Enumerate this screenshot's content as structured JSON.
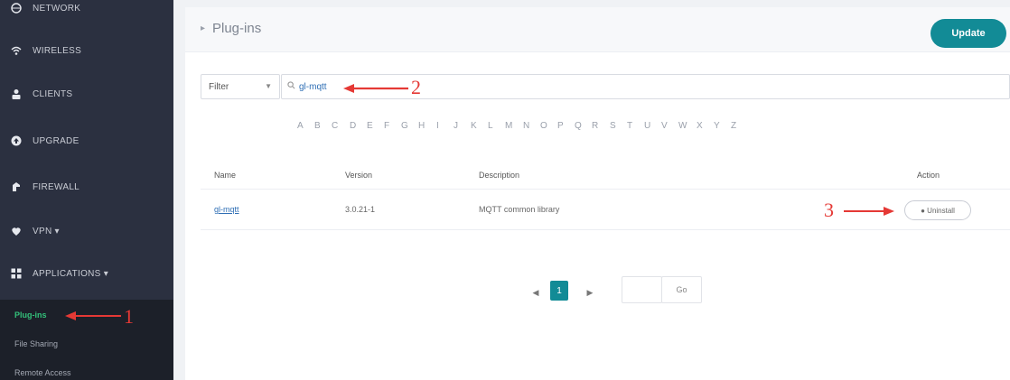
{
  "sidebar": {
    "items": [
      {
        "label": "NETWORK",
        "icon": "globe-icon"
      },
      {
        "label": "WIRELESS",
        "icon": "wifi-icon"
      },
      {
        "label": "CLIENTS",
        "icon": "user-icon"
      },
      {
        "label": "UPGRADE",
        "icon": "upgrade-icon"
      },
      {
        "label": "FIREWALL",
        "icon": "firewall-icon"
      },
      {
        "label": "VPN ▾",
        "icon": "vpn-icon"
      },
      {
        "label": "APPLICATIONS ▾",
        "icon": "grid-icon"
      }
    ],
    "submenu": [
      {
        "label": "Plug-ins",
        "active": true
      },
      {
        "label": "File Sharing",
        "active": false
      },
      {
        "label": "Remote Access",
        "active": false
      }
    ]
  },
  "header": {
    "breadcrumb_arrow": "▸",
    "title": "Plug-ins",
    "update_label": "Update"
  },
  "filter": {
    "select_value": "Filter",
    "search_value": "gl-mqtt",
    "search_icon": "search-icon"
  },
  "alphabet": [
    "A",
    "B",
    "C",
    "D",
    "E",
    "F",
    "G",
    "H",
    "I",
    "J",
    "K",
    "L",
    "M",
    "N",
    "O",
    "P",
    "Q",
    "R",
    "S",
    "T",
    "U",
    "V",
    "W",
    "X",
    "Y",
    "Z"
  ],
  "table": {
    "headers": {
      "name": "Name",
      "version": "Version",
      "description": "Description",
      "action": "Action"
    },
    "rows": [
      {
        "name": "gl-mqtt",
        "version": "3.0.21-1",
        "description": "MQTT common library",
        "action": "● Uninstall"
      }
    ]
  },
  "pagination": {
    "prev": "◀",
    "current": "1",
    "next": "▶",
    "go_label": "Go"
  },
  "annotations": {
    "step1": "1",
    "step2": "2",
    "step3": "3",
    "color": "#e53935"
  },
  "colors": {
    "sidebar_bg": "#2b3040",
    "accent": "#128b96",
    "active_green": "#33c17a"
  }
}
